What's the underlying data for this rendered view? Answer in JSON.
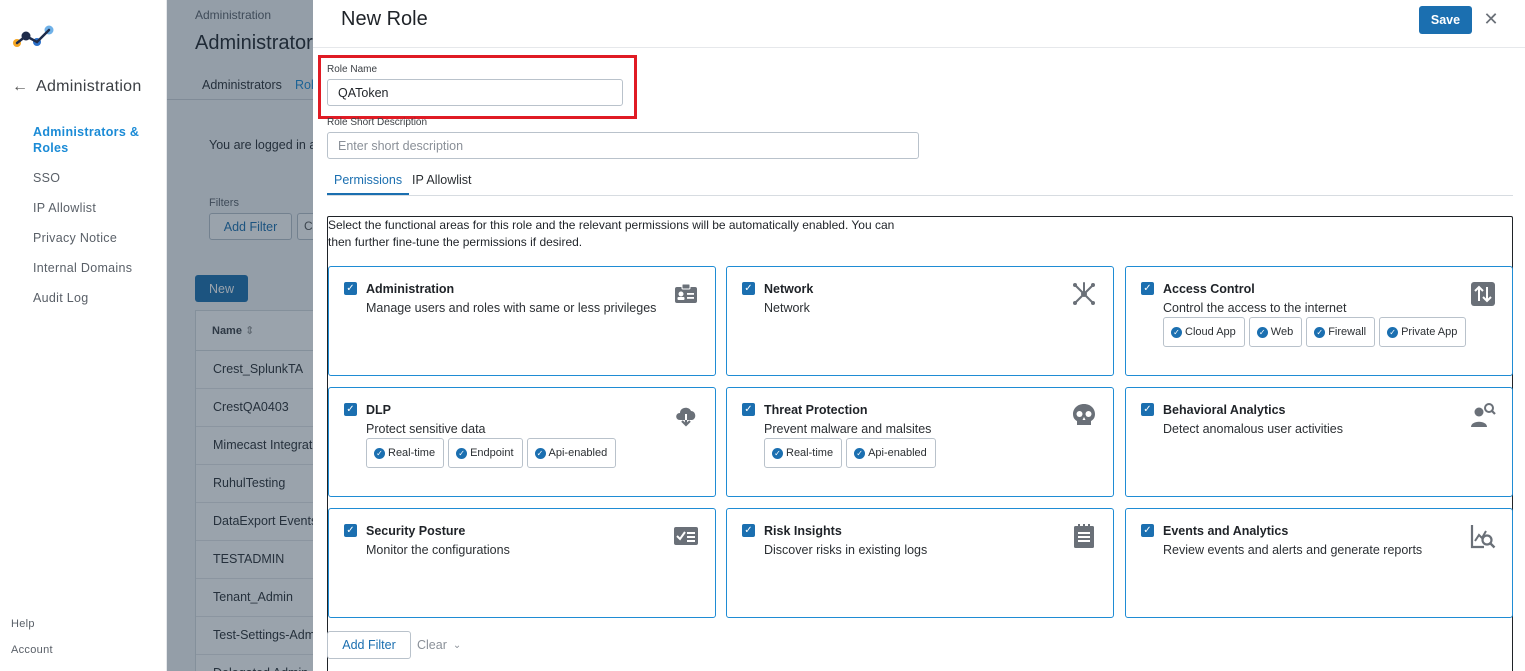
{
  "sidebar": {
    "back_label": "Administration",
    "items": [
      {
        "label": "Administrators & Roles",
        "active": true
      },
      {
        "label": "SSO",
        "active": false
      },
      {
        "label": "IP Allowlist",
        "active": false
      },
      {
        "label": "Privacy Notice",
        "active": false
      },
      {
        "label": "Internal Domains",
        "active": false
      },
      {
        "label": "Audit Log",
        "active": false
      }
    ],
    "help": "Help",
    "account": "Account"
  },
  "background": {
    "breadcrumb": "Administration",
    "title": "Administrators",
    "tabs": [
      "Administrators",
      "Roles"
    ],
    "logged_in_text": "You are logged in as",
    "filters_label": "Filters",
    "add_filter": "Add Filter",
    "new_button": "New",
    "table_header": "Name",
    "rows": [
      "Crest_SplunkTA",
      "CrestQA0403",
      "Mimecast Integration",
      "RuhulTesting",
      "DataExport Events",
      "TESTADMIN",
      "Tenant_Admin",
      "Test-Settings-Admin",
      "Delegated Admin"
    ]
  },
  "drawer": {
    "title": "New Role",
    "save_label": "Save",
    "close_icon": "close-icon",
    "role_name_label": "Role Name",
    "role_name_value": "QAToken",
    "short_desc_label": "Role Short Description",
    "short_desc_placeholder": "Enter short description",
    "tabs": [
      "Permissions",
      "IP Allowlist"
    ],
    "intro_text": "Select the functional areas for this role and the relevant permissions will be automatically enabled. You can then further fine-tune the permissions if desired.",
    "cards": [
      {
        "title": "Administration",
        "desc": "Manage users and roles with same or less privileges",
        "icon": "id-card-icon",
        "chips": []
      },
      {
        "title": "Network",
        "desc": "Network",
        "icon": "network-hub-icon",
        "chips": []
      },
      {
        "title": "Access Control",
        "desc": "Control the access to the internet",
        "icon": "up-down-arrows-icon",
        "chips": [
          "Cloud App",
          "Web",
          "Firewall",
          "Private App"
        ]
      },
      {
        "title": "DLP",
        "desc": "Protect sensitive data",
        "icon": "cloud-download-icon",
        "chips": [
          "Real-time",
          "Endpoint",
          "Api-enabled"
        ]
      },
      {
        "title": "Threat Protection",
        "desc": "Prevent malware and malsites",
        "icon": "skull-icon",
        "chips": [
          "Real-time",
          "Api-enabled"
        ]
      },
      {
        "title": "Behavioral Analytics",
        "desc": "Detect anomalous user activities",
        "icon": "user-search-icon",
        "chips": []
      },
      {
        "title": "Security Posture",
        "desc": "Monitor the configurations",
        "icon": "checklist-icon",
        "chips": []
      },
      {
        "title": "Risk Insights",
        "desc": "Discover risks in existing logs",
        "icon": "notepad-icon",
        "chips": []
      },
      {
        "title": "Events and Analytics",
        "desc": "Review events and alerts and generate reports",
        "icon": "chart-search-icon",
        "chips": []
      }
    ],
    "bottom_add_filter": "Add Filter",
    "bottom_clear": "Clear"
  },
  "colors": {
    "accent": "#1b6fb0",
    "card_border": "#1f8cd4",
    "highlight": "#e01b24"
  }
}
